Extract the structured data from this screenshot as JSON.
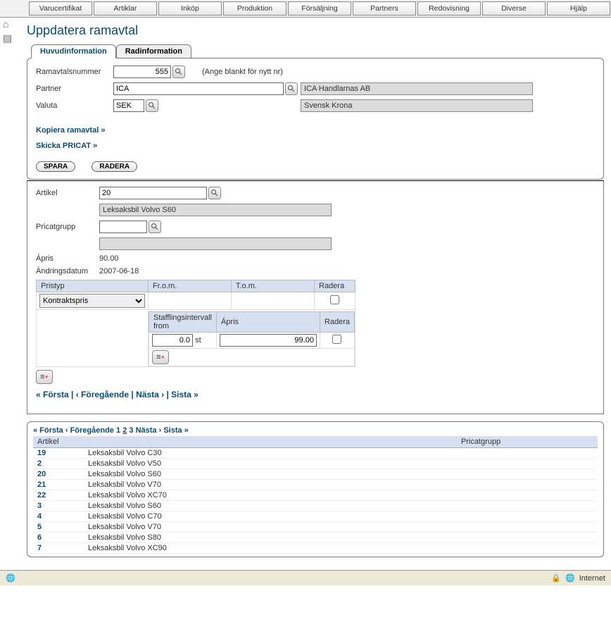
{
  "topbar": [
    "Varucertifikat",
    "Artiklar",
    "Inköp",
    "Produktion",
    "Försäljning",
    "Partners",
    "Redovisning",
    "Diverse",
    "Hjälp"
  ],
  "page_title": "Uppdatera ramavtal",
  "tabs": {
    "main": "Huvudinformation",
    "rows": "Radinformation"
  },
  "head": {
    "ramavtal_label": "Ramavtalsnummer",
    "ramavtal_value": "555",
    "ramavtal_hint": "(Ange blankt för nytt nr)",
    "partner_label": "Partner",
    "partner_value": "ICA",
    "partner_display": "ICA Handlarnas AB",
    "valuta_label": "Valuta",
    "valuta_value": "SEK",
    "valuta_display": "Svensk Krona",
    "copy_link": "Kopiera ramavtal »",
    "pricat_link": "Skicka PRICAT »",
    "save_btn": "SPARA",
    "delete_btn": "RADERA"
  },
  "mid": {
    "artikel_label": "Artikel",
    "artikel_value": "20",
    "artikel_display": "Leksaksbil Volvo S60",
    "pricat_label": "Pricatgrupp",
    "pricat_value": "",
    "pricat_display": "",
    "apris_label": "Ápris",
    "apris_value": "90.00",
    "andr_label": "Ändringsdatum",
    "andr_value": "2007-06-18",
    "cols": {
      "pristyp": "Pristyp",
      "from": "Fr.o.m.",
      "tom": "T.o.m.",
      "radera": "Radera"
    },
    "pristyp_value": "Kontraktspris",
    "inner_cols": {
      "staff": "Stafflingsintervall from",
      "apris": "Ápris",
      "radera": "Radera"
    },
    "inner_from": "0.0",
    "inner_unit": "st",
    "inner_apris": "99.00"
  },
  "pager": {
    "first": "« Första",
    "prev": "‹ Föregående",
    "next": "Nästa ›",
    "last": "Sista »",
    "p1": "1",
    "p2": "2",
    "p3": "3"
  },
  "list": {
    "cols": {
      "artikel": "Artikel",
      "pricat": "Pricatgrupp"
    },
    "rows": [
      {
        "id": "19",
        "name": "Leksaksbil Volvo C30"
      },
      {
        "id": "2",
        "name": "Leksaksbil Volvo V50"
      },
      {
        "id": "20",
        "name": "Leksaksbil Volvo S60"
      },
      {
        "id": "21",
        "name": "Leksaksbil Volvo V70"
      },
      {
        "id": "22",
        "name": "Leksaksbil Volvo XC70"
      },
      {
        "id": "3",
        "name": "Leksaksbil Volvo S60"
      },
      {
        "id": "4",
        "name": "Leksaksbil Volvo C70"
      },
      {
        "id": "5",
        "name": "Leksaksbil Volvo V70"
      },
      {
        "id": "6",
        "name": "Leksaksbil Volvo S80"
      },
      {
        "id": "7",
        "name": "Leksaksbil Volvo XC90"
      }
    ]
  },
  "status": {
    "zone": "Internet"
  }
}
